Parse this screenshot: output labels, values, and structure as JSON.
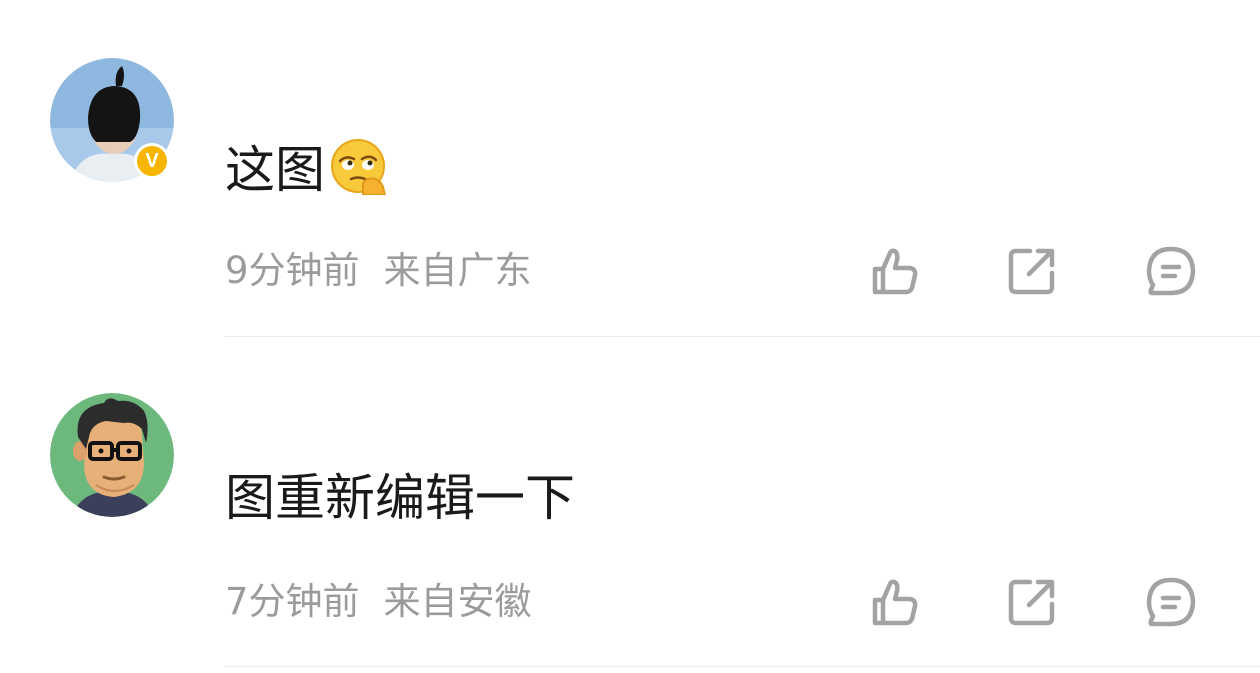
{
  "comments": [
    {
      "text": "这图",
      "emoji": "thinking-eye-roll-emoji",
      "time": "9分钟前",
      "location": "来自广东",
      "verified": true,
      "verified_badge": "V"
    },
    {
      "text": "图重新编辑一下",
      "time": "7分钟前",
      "location": "来自安徽",
      "verified": false
    }
  ],
  "actions": [
    "like-icon",
    "share-icon",
    "reply-icon"
  ],
  "colors": {
    "text": "#1a1a1a",
    "meta": "#9b9b9b",
    "icon": "#a3a3a3",
    "badge": "#f7b500",
    "divider": "#ececec"
  }
}
